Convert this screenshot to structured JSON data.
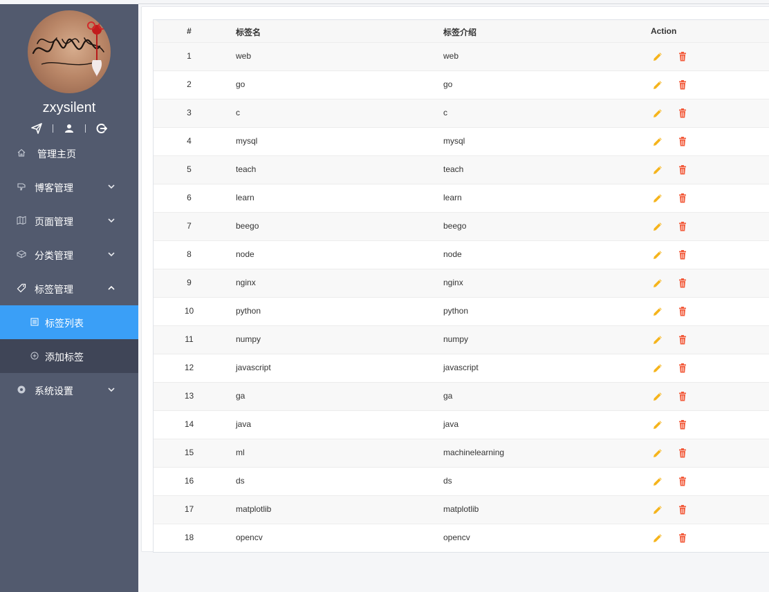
{
  "colors": {
    "sidebar_bg": "#525a6e",
    "submenu_bg": "#3f4557",
    "active_bg": "#3a9ff7",
    "edit_icon": "#f5b41c",
    "delete_icon": "#f25a3a"
  },
  "sidebar": {
    "username": "zxysilent",
    "avatar_signature": "黄裕智",
    "tools": [
      "send-icon",
      "user-icon",
      "logout-icon"
    ],
    "menu": [
      {
        "label": "管理主页",
        "icon": "home-icon"
      },
      {
        "label": "博客管理",
        "icon": "thumb-icon",
        "chevron": "down"
      },
      {
        "label": "页面管理",
        "icon": "map-icon",
        "chevron": "down"
      },
      {
        "label": "分类管理",
        "icon": "cube-icon",
        "chevron": "down"
      },
      {
        "label": "标签管理",
        "icon": "tag-icon",
        "chevron": "up",
        "expanded": true,
        "children": [
          {
            "label": "标签列表",
            "icon": "list-icon",
            "active": true
          },
          {
            "label": "添加标签",
            "icon": "plus-circle-icon"
          }
        ]
      },
      {
        "label": "系统设置",
        "icon": "settings-icon",
        "chevron": "down"
      }
    ]
  },
  "table": {
    "columns": [
      "#",
      "标签名",
      "标签介绍",
      "Action"
    ],
    "rows": [
      {
        "idx": "1",
        "name": "web",
        "intro": "web"
      },
      {
        "idx": "2",
        "name": "go",
        "intro": "go"
      },
      {
        "idx": "3",
        "name": "c",
        "intro": "c"
      },
      {
        "idx": "4",
        "name": "mysql",
        "intro": "mysql"
      },
      {
        "idx": "5",
        "name": "teach",
        "intro": "teach"
      },
      {
        "idx": "6",
        "name": "learn",
        "intro": "learn"
      },
      {
        "idx": "7",
        "name": "beego",
        "intro": "beego"
      },
      {
        "idx": "8",
        "name": "node",
        "intro": "node"
      },
      {
        "idx": "9",
        "name": "nginx",
        "intro": "nginx"
      },
      {
        "idx": "10",
        "name": "python",
        "intro": "python"
      },
      {
        "idx": "11",
        "name": "numpy",
        "intro": "numpy"
      },
      {
        "idx": "12",
        "name": "javascript",
        "intro": "javascript"
      },
      {
        "idx": "13",
        "name": "ga",
        "intro": "ga"
      },
      {
        "idx": "14",
        "name": "java",
        "intro": "java"
      },
      {
        "idx": "15",
        "name": "ml",
        "intro": "machinelearning"
      },
      {
        "idx": "16",
        "name": "ds",
        "intro": "ds"
      },
      {
        "idx": "17",
        "name": "matplotlib",
        "intro": "matplotlib"
      },
      {
        "idx": "18",
        "name": "opencv",
        "intro": "opencv"
      }
    ],
    "actions": [
      "edit-icon",
      "delete-icon"
    ]
  }
}
